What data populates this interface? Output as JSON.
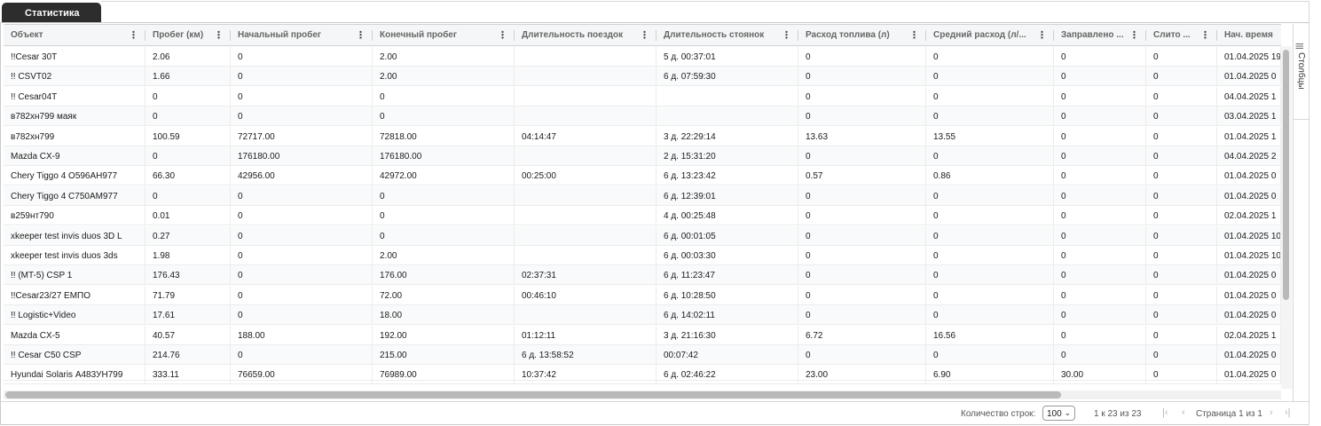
{
  "tab": {
    "label": "Статистика"
  },
  "table": {
    "columns": [
      "Объект",
      "Пробег (км)",
      "Начальный пробег",
      "Конечный пробег",
      "Длительность поездок",
      "Длительность стоянок",
      "Расход топлива (л)",
      "Средний расход (л/...",
      "Заправлено ...",
      "Слито ...",
      "Нач. время"
    ],
    "rows": [
      [
        "!!Cesar 30T",
        "2.06",
        "0",
        "2.00",
        "",
        "5 д. 00:37:01",
        "0",
        "0",
        "0",
        "0",
        "01.04.2025 19"
      ],
      [
        "!! CSVT02",
        "1.66",
        "0",
        "2.00",
        "",
        "6 д. 07:59:30",
        "0",
        "0",
        "0",
        "0",
        "01.04.2025 0"
      ],
      [
        "!! Cesar04T",
        "0",
        "0",
        "0",
        "",
        "",
        "0",
        "0",
        "0",
        "0",
        "04.04.2025 1"
      ],
      [
        "в782хн799 маяк",
        "0",
        "0",
        "0",
        "",
        "",
        "0",
        "0",
        "0",
        "0",
        "03.04.2025 1"
      ],
      [
        "в782хн799",
        "100.59",
        "72717.00",
        "72818.00",
        "04:14:47",
        "3 д. 22:29:14",
        "13.63",
        "13.55",
        "0",
        "0",
        "01.04.2025 1"
      ],
      [
        "Mazda CX-9",
        "0",
        "176180.00",
        "176180.00",
        "",
        "2 д. 15:31:20",
        "0",
        "0",
        "0",
        "0",
        "04.04.2025 2"
      ],
      [
        "Chery Tiggo 4 О596АН977",
        "66.30",
        "42956.00",
        "42972.00",
        "00:25:00",
        "6 д. 13:23:42",
        "0.57",
        "0.86",
        "0",
        "0",
        "01.04.2025 0"
      ],
      [
        "Chery Tiggo 4 С750АМ977",
        "0",
        "0",
        "0",
        "",
        "6 д. 12:39:01",
        "0",
        "0",
        "0",
        "0",
        "01.04.2025 0"
      ],
      [
        "в259нт790",
        "0.01",
        "0",
        "0",
        "",
        "4 д. 00:25:48",
        "0",
        "0",
        "0",
        "0",
        "02.04.2025 1"
      ],
      [
        "xkeeper test invis duos 3D L",
        "0.27",
        "0",
        "0",
        "",
        "6 д. 00:01:05",
        "0",
        "0",
        "0",
        "0",
        "01.04.2025 10"
      ],
      [
        "xkeeper test invis duos 3ds",
        "1.98",
        "0",
        "2.00",
        "",
        "6 д. 00:03:30",
        "0",
        "0",
        "0",
        "0",
        "01.04.2025 10"
      ],
      [
        "!! (MT-5) CSP 1",
        "176.43",
        "0",
        "176.00",
        "02:37:31",
        "6 д. 11:23:47",
        "0",
        "0",
        "0",
        "0",
        "01.04.2025 0"
      ],
      [
        "!!Cesar23/27 ЕМПО",
        "71.79",
        "0",
        "72.00",
        "00:46:10",
        "6 д. 10:28:50",
        "0",
        "0",
        "0",
        "0",
        "01.04.2025 0"
      ],
      [
        "!! Logistic+Video",
        "17.61",
        "0",
        "18.00",
        "",
        "6 д. 14:02:11",
        "0",
        "0",
        "0",
        "0",
        "01.04.2025 0"
      ],
      [
        "Mazda CX-5",
        "40.57",
        "188.00",
        "192.00",
        "01:12:11",
        "3 д. 21:16:30",
        "6.72",
        "16.56",
        "0",
        "0",
        "02.04.2025 1"
      ],
      [
        "!! Cesar C50 CSP",
        "214.76",
        "0",
        "215.00",
        "6 д. 13:58:52",
        "00:07:42",
        "0",
        "0",
        "0",
        "0",
        "01.04.2025 0"
      ],
      [
        "Hyundai Solaris А483УН799",
        "333.11",
        "76659.00",
        "76989.00",
        "10:37:42",
        "6 д. 02:46:22",
        "23.00",
        "6.90",
        "30.00",
        "0",
        "01.04.2025 0"
      ]
    ]
  },
  "side_panel": {
    "columns_label": "Столбцы",
    "icon": "list-icon"
  },
  "footer": {
    "rows_per_page_label": "Количество строк:",
    "rows_per_page_value": "100",
    "range_text": "1 к 23 из 23",
    "page_text": "Страница 1 из 1"
  },
  "colors": {
    "tab_bg": "#2d2d2d",
    "header_bg": "#f5f6f7",
    "border": "#d3d3d3"
  }
}
